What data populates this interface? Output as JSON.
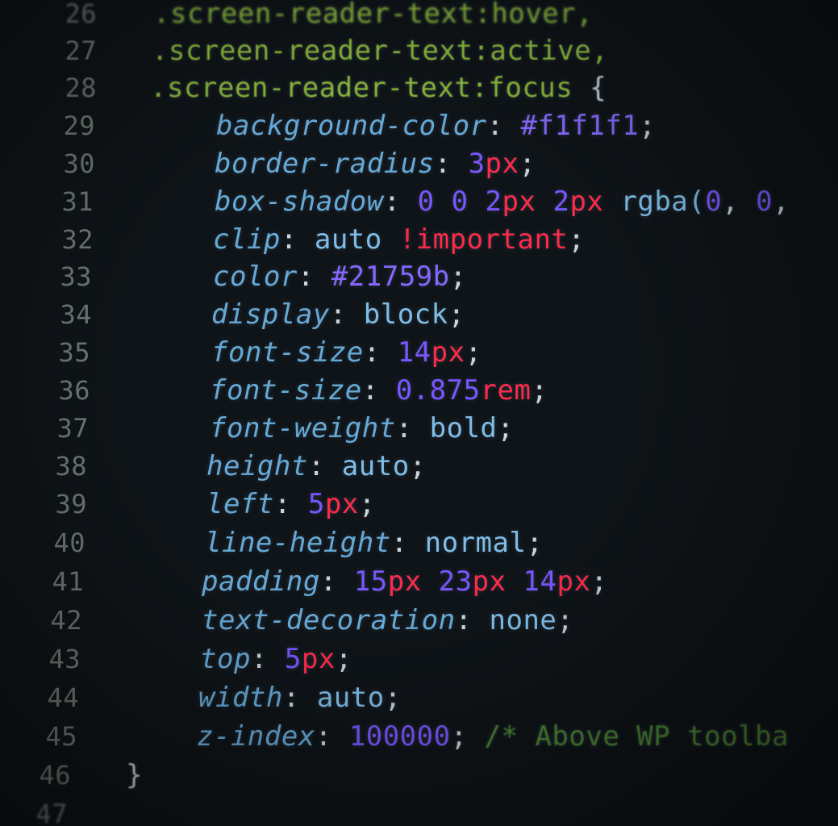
{
  "lines": [
    {
      "n": "26",
      "tokens": [
        ".screen-reader-text:hover,"
      ]
    },
    {
      "n": "27",
      "tokens": [
        ".screen-reader-text:active,"
      ]
    },
    {
      "n": "28",
      "tokens": [
        ".screen-reader-text:focus",
        " {"
      ]
    },
    {
      "n": "29",
      "tokens": [
        "background-color",
        ": ",
        "#f1f1f1",
        ";"
      ]
    },
    {
      "n": "30",
      "tokens": [
        "border-radius",
        ": ",
        "3",
        "px",
        ";"
      ]
    },
    {
      "n": "31",
      "tokens": [
        "box-shadow",
        ": ",
        "0 0 ",
        "2",
        "px",
        " ",
        "2",
        "px",
        " rgba(",
        "0",
        ", ",
        "0",
        ","
      ]
    },
    {
      "n": "32",
      "tokens": [
        "clip",
        ": ",
        "auto ",
        "!important",
        ";"
      ]
    },
    {
      "n": "33",
      "tokens": [
        "color",
        ": ",
        "#21759b",
        ";"
      ]
    },
    {
      "n": "34",
      "tokens": [
        "display",
        ": ",
        "block",
        ";"
      ]
    },
    {
      "n": "35",
      "tokens": [
        "font-size",
        ": ",
        "14",
        "px",
        ";"
      ]
    },
    {
      "n": "36",
      "tokens": [
        "font-size",
        ": ",
        "0.875",
        "rem",
        ";"
      ]
    },
    {
      "n": "37",
      "tokens": [
        "font-weight",
        ": ",
        "bold",
        ";"
      ]
    },
    {
      "n": "38",
      "tokens": [
        "height",
        ": ",
        "auto",
        ";"
      ]
    },
    {
      "n": "39",
      "tokens": [
        "left",
        ": ",
        "5",
        "px",
        ";"
      ]
    },
    {
      "n": "40",
      "tokens": [
        "line-height",
        ": ",
        "normal",
        ";"
      ]
    },
    {
      "n": "41",
      "tokens": [
        "padding",
        ": ",
        "15",
        "px",
        " ",
        "23",
        "px",
        " ",
        "14",
        "px",
        ";"
      ]
    },
    {
      "n": "42",
      "tokens": [
        "text-decoration",
        ": ",
        "none",
        ";"
      ]
    },
    {
      "n": "43",
      "tokens": [
        "top",
        ": ",
        "5",
        "px",
        ";"
      ]
    },
    {
      "n": "44",
      "tokens": [
        "width",
        ": ",
        "auto",
        ";"
      ]
    },
    {
      "n": "45",
      "tokens": [
        "z-index",
        ": ",
        "100000",
        "; ",
        "/* Above WP toolba"
      ]
    },
    {
      "n": "46",
      "tokens": [
        "}"
      ]
    },
    {
      "n": "47",
      "tokens": []
    }
  ],
  "colors": {
    "background": "#0f1418",
    "selector": "#8fbe3c",
    "property": "#66a9d6",
    "number": "#7b55ff",
    "unit": "#ff2a4a",
    "comment": "#4f8a33"
  }
}
